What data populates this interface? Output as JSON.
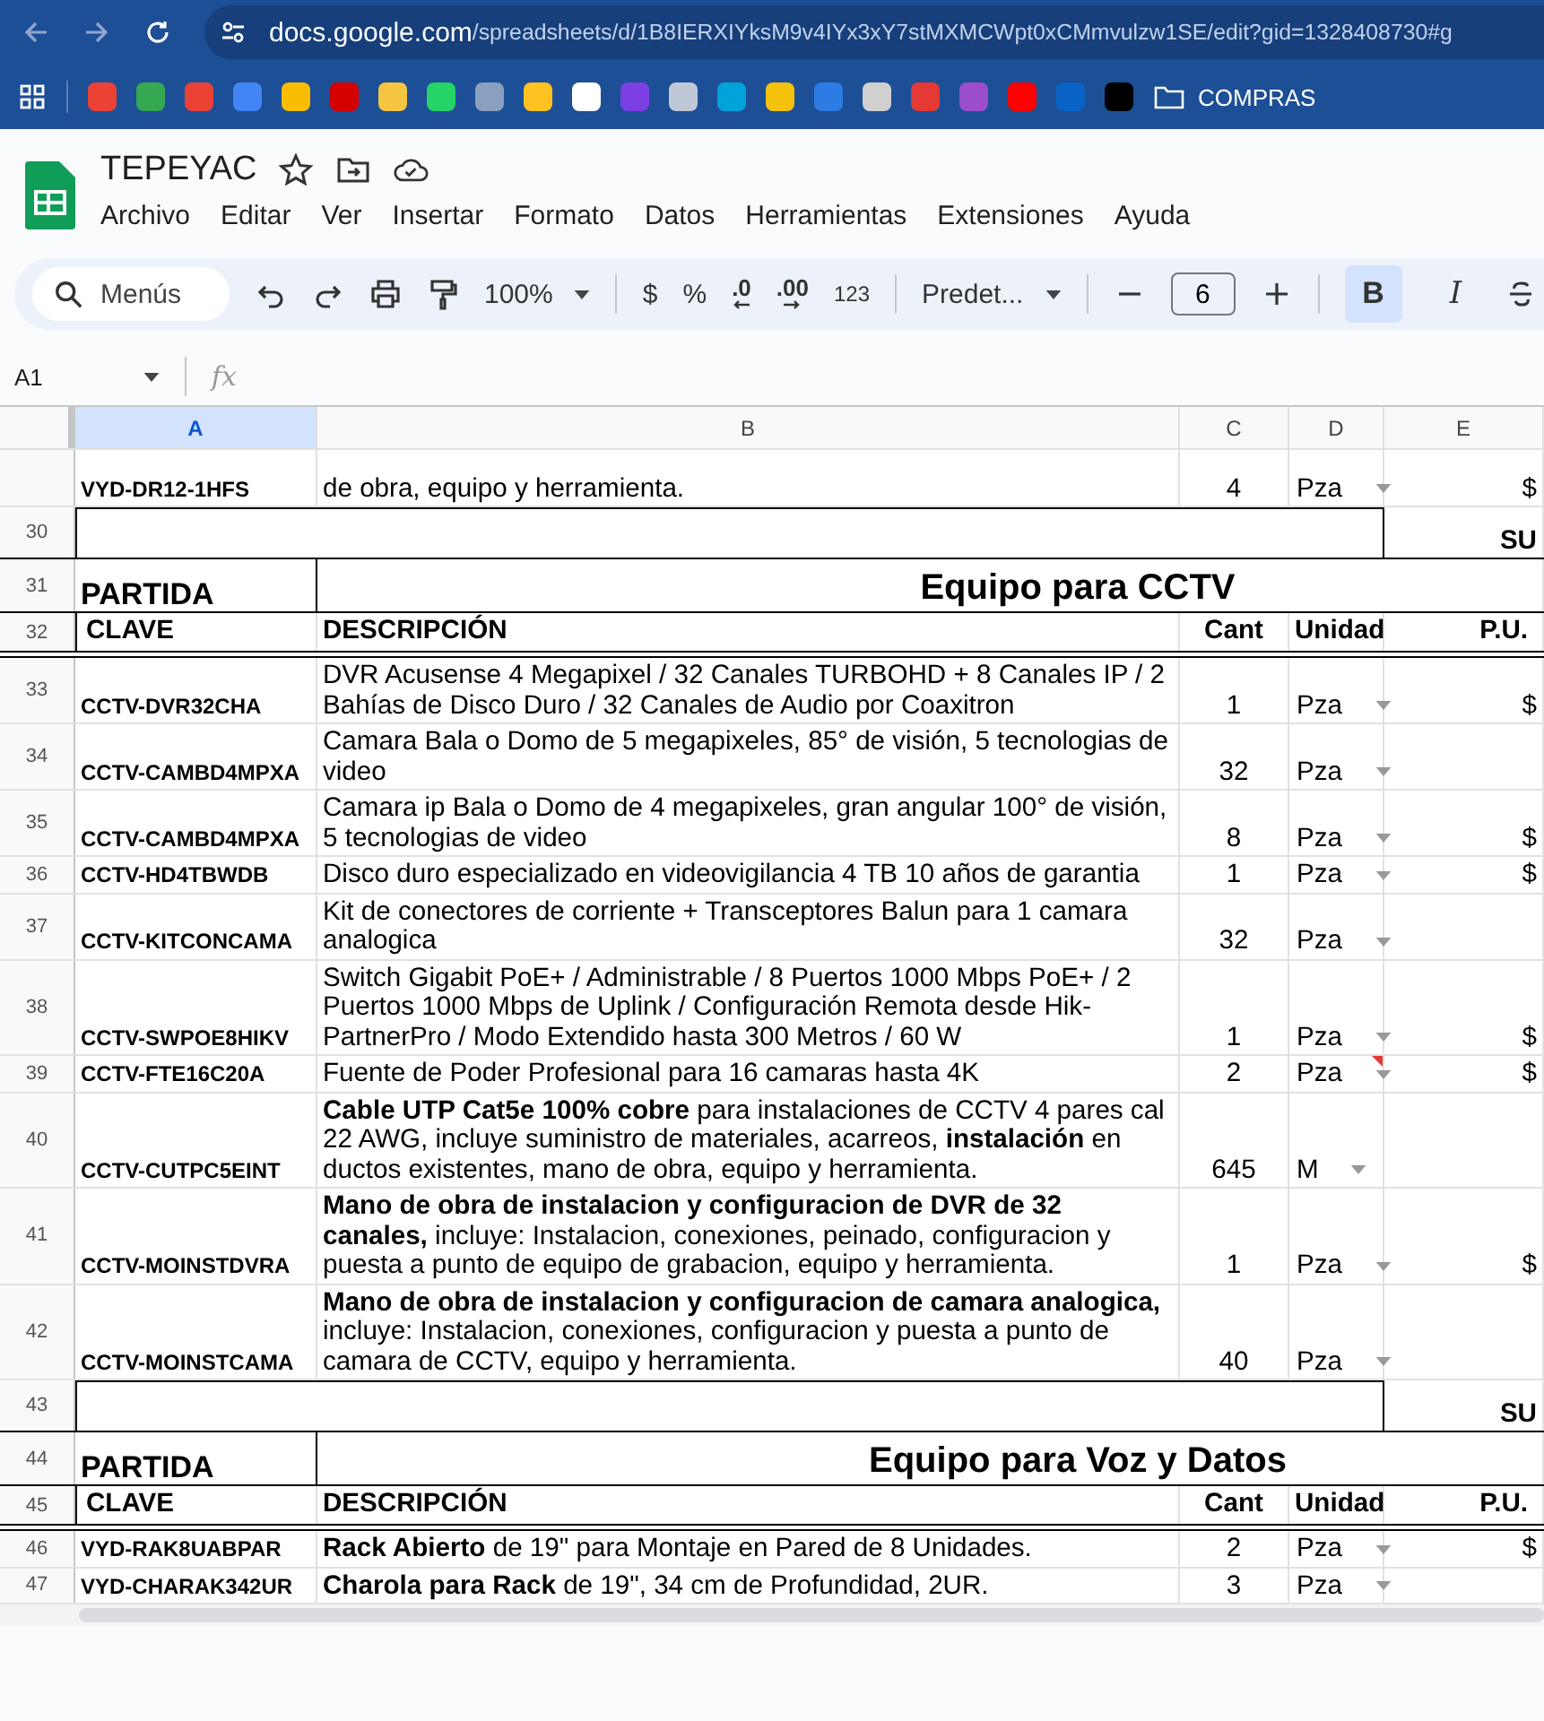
{
  "browser": {
    "url_host": "docs.google.com",
    "url_path": "/spreadsheets/d/1B8IERXIYksM9v4IYx3xY7stMXMCWpt0xCMmvulzw1SE/edit?gid=1328408730#g",
    "bookmarks": [
      {
        "color": "#ea4335"
      },
      {
        "color": "#34a853"
      },
      {
        "color": "#ea4335"
      },
      {
        "color": "#4285f4"
      },
      {
        "color": "#fbbc04"
      },
      {
        "color": "#d50000"
      },
      {
        "color": "#f5c542"
      },
      {
        "color": "#25d366"
      },
      {
        "color": "#8aa0c0"
      },
      {
        "color": "#ffc220"
      },
      {
        "color": "#ffffff"
      },
      {
        "color": "#7b3fe4"
      },
      {
        "color": "#c0c8d8"
      },
      {
        "color": "#00a3d9"
      },
      {
        "color": "#f4c20d"
      },
      {
        "color": "#2d7be5"
      },
      {
        "color": "#d0d0d0"
      },
      {
        "color": "#e53935"
      },
      {
        "color": "#9c4dcc"
      },
      {
        "color": "#ff0000"
      },
      {
        "color": "#0a64c8"
      },
      {
        "color": "#000000"
      }
    ],
    "folder": "COMPRAS"
  },
  "document": {
    "title": "TEPEYAC",
    "menu": [
      "Archivo",
      "Editar",
      "Ver",
      "Insertar",
      "Formato",
      "Datos",
      "Herramientas",
      "Extensiones",
      "Ayuda"
    ]
  },
  "toolbar": {
    "search_placeholder": "Menús",
    "zoom": "100%",
    "currency": "$",
    "percent": "%",
    "decrease_decimals": ".0",
    "increase_decimals": ".00",
    "number_format": "123",
    "font": "Predet...",
    "font_size": "6",
    "bold": {
      "label": "B",
      "selected": true
    },
    "italic": {
      "label": "I",
      "selected": false
    }
  },
  "formula_bar": {
    "cell_ref": "A1",
    "fx": "fx"
  },
  "columns": [
    {
      "label": "A",
      "selected": true
    },
    {
      "label": "B",
      "selected": false
    },
    {
      "label": "C",
      "selected": false
    },
    {
      "label": "D",
      "selected": false
    },
    {
      "label": "E",
      "selected": false
    }
  ],
  "rows": [
    {
      "kind": "item",
      "clave": "VYD-DR12-1HFS",
      "description": "de obra, equipo y herramienta.",
      "cant": "4",
      "unidad": "Pza",
      "pu": "$"
    },
    {
      "kind": "subtotal",
      "number": "30",
      "label": "SU"
    },
    {
      "kind": "section",
      "number": "31",
      "label": "PARTIDA",
      "title": "Equipo para CCTV"
    },
    {
      "kind": "header",
      "number": "32",
      "clave": "CLAVE",
      "description": "DESCRIPCIÓN",
      "cant": "Cant",
      "unidad": "Unidad",
      "pu": "P.U."
    },
    {
      "kind": "item",
      "number": "33",
      "clave": "CCTV-DVR32CHA",
      "description": "DVR Acusense 4 Megapixel / 32 Canales TURBOHD + 8 Canales IP / 2 Bahías de Disco Duro / 32 Canales de Audio por Coaxitron",
      "cant": "1",
      "unidad": "Pza",
      "pu": "$"
    },
    {
      "kind": "item",
      "number": "34",
      "clave": "CCTV-CAMBD4MPXA",
      "description": "Camara Bala o Domo de 5 megapixeles, 85° de visión, 5 tecnologias de video",
      "cant": "32",
      "unidad": "Pza"
    },
    {
      "kind": "item",
      "number": "35",
      "clave": "CCTV-CAMBD4MPXA",
      "description": "Camara ip  Bala o Domo de 4 megapixeles, gran angular 100° de visión, 5 tecnologias de video",
      "cant": "8",
      "unidad": "Pza",
      "pu": "$"
    },
    {
      "kind": "item",
      "number": "36",
      "clave": "CCTV-HD4TBWDB",
      "description": "Disco duro especializado en videovigilancia 4 TB 10 años de garantia",
      "cant": "1",
      "unidad": "Pza",
      "pu": "$"
    },
    {
      "kind": "item",
      "number": "37",
      "clave": "CCTV-KITCONCAMA",
      "description": "Kit de conectores de corriente + Transceptores Balun para 1 camara analogica",
      "cant": "32",
      "unidad": "Pza"
    },
    {
      "kind": "item",
      "number": "38",
      "clave": "CCTV-SWPOE8HIKV",
      "description": "Switch Gigabit PoE+ / Administrable / 8 Puertos 1000 Mbps PoE+ / 2 Puertos 1000 Mbps de Uplink / Configuración Remota desde Hik-PartnerPro / Modo Extendido hasta 300 Metros / 60 W",
      "cant": "1",
      "unidad": "Pza",
      "pu": "$"
    },
    {
      "kind": "item",
      "number": "39",
      "clave": "CCTV-FTE16C20A",
      "description": "Fuente de Poder Profesional para 16 camaras hasta 4K",
      "cant": "2",
      "unidad": "Pza",
      "pu": "$",
      "comment": true
    },
    {
      "kind": "item",
      "number": "40",
      "clave": "CCTV-CUTPC5EINT",
      "description": "**Cable UTP Cat5e 100% cobre** para instalaciones de CCTV 4 pares cal 22 AWG, incluye suministro de materiales, acarreos, **instalación** en ductos existentes, mano de obra, equipo y herramienta.",
      "cant": "645",
      "unidad": "M"
    },
    {
      "kind": "item",
      "number": "41",
      "clave": "CCTV-MOINSTDVRA",
      "description": "**Mano de obra de instalacion y configuracion de DVR de 32 canales,** incluye: Instalacion, conexiones, peinado, configuracion y puesta a punto de equipo de grabacion, equipo y herramienta.",
      "cant": "1",
      "unidad": "Pza",
      "pu": "$"
    },
    {
      "kind": "item",
      "number": "42",
      "clave": "CCTV-MOINSTCAMA",
      "description": "**Mano de obra de instalacion y configuracion de camara analogica,** incluye: Instalacion, conexiones, configuracion y puesta a punto de camara de CCTV, equipo y herramienta.",
      "cant": "40",
      "unidad": "Pza"
    },
    {
      "kind": "subtotal",
      "number": "43",
      "label": "SU"
    },
    {
      "kind": "section",
      "number": "44",
      "label": "PARTIDA",
      "title": "Equipo para Voz y Datos"
    },
    {
      "kind": "header",
      "number": "45",
      "clave": "CLAVE",
      "description": "DESCRIPCIÓN",
      "cant": "Cant",
      "unidad": "Unidad",
      "pu": "P.U."
    },
    {
      "kind": "item",
      "number": "46",
      "clave": "VYD-RAK8UABPAR",
      "description": "**Rack Abierto** de 19\" para Montaje en Pared de 8 Unidades.",
      "cant": "2",
      "unidad": "Pza",
      "pu": "$"
    },
    {
      "kind": "item",
      "number": "47",
      "clave": "VYD-CHARAK342UR",
      "description": "**Charola para Rack** de 19\", 34 cm de Profundidad, 2UR.",
      "cant": "3",
      "unidad": "Pza"
    }
  ]
}
